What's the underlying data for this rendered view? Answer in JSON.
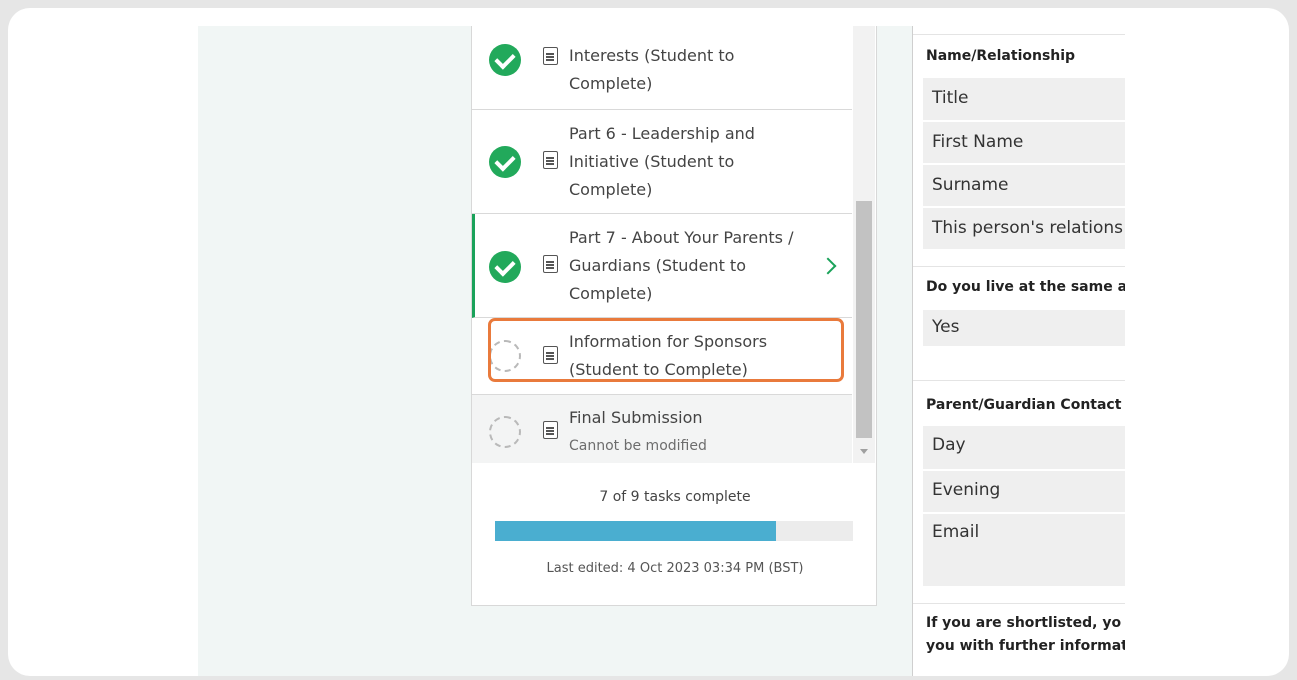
{
  "tasks": [
    {
      "label": "Interests (Student to Complete)",
      "status": "complete"
    },
    {
      "label": "Part 6 - Leadership and Initiative (Student to Complete)",
      "status": "complete"
    },
    {
      "label": "Part 7 - About Your Parents / Guardians (Student to Complete)",
      "status": "complete"
    },
    {
      "label": "Information for Sponsors (Student to Complete)",
      "status": "incomplete"
    },
    {
      "label": "Final Submission",
      "sublabel": "Cannot be modified",
      "status": "locked"
    }
  ],
  "progress": {
    "text": "7 of 9 tasks complete",
    "fraction": 0.785
  },
  "last_edited": "Last edited: 4 Oct 2023 03:34 PM (BST)",
  "form": {
    "section1_heading": "Name/Relationship",
    "section1_fields": [
      "Title",
      "First Name",
      "Surname",
      "This person's relations"
    ],
    "section2_heading": "Do you live at the same a",
    "section2_value": "Yes",
    "section3_heading": "Parent/Guardian Contact",
    "section3_fields": [
      "Day",
      "Evening",
      "Email"
    ],
    "note_line1": "If you are shortlisted, yo",
    "note_line2": "you with further informat"
  },
  "colors": {
    "complete": "#22a95b",
    "highlight": "#e97a3c",
    "progress": "#4aaed0"
  }
}
